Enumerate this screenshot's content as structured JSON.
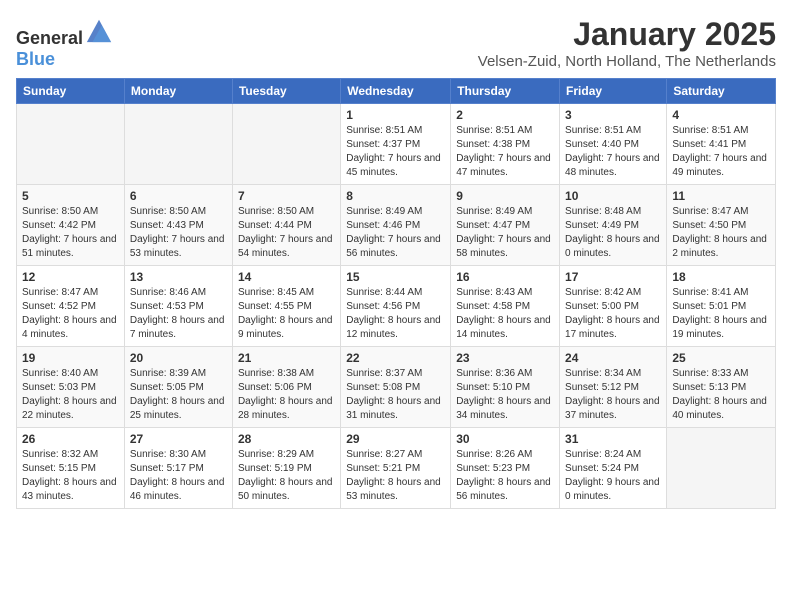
{
  "header": {
    "logo_general": "General",
    "logo_blue": "Blue",
    "month": "January 2025",
    "location": "Velsen-Zuid, North Holland, The Netherlands"
  },
  "weekdays": [
    "Sunday",
    "Monday",
    "Tuesday",
    "Wednesday",
    "Thursday",
    "Friday",
    "Saturday"
  ],
  "weeks": [
    [
      {
        "day": "",
        "info": ""
      },
      {
        "day": "",
        "info": ""
      },
      {
        "day": "",
        "info": ""
      },
      {
        "day": "1",
        "info": "Sunrise: 8:51 AM\nSunset: 4:37 PM\nDaylight: 7 hours and 45 minutes."
      },
      {
        "day": "2",
        "info": "Sunrise: 8:51 AM\nSunset: 4:38 PM\nDaylight: 7 hours and 47 minutes."
      },
      {
        "day": "3",
        "info": "Sunrise: 8:51 AM\nSunset: 4:40 PM\nDaylight: 7 hours and 48 minutes."
      },
      {
        "day": "4",
        "info": "Sunrise: 8:51 AM\nSunset: 4:41 PM\nDaylight: 7 hours and 49 minutes."
      }
    ],
    [
      {
        "day": "5",
        "info": "Sunrise: 8:50 AM\nSunset: 4:42 PM\nDaylight: 7 hours and 51 minutes."
      },
      {
        "day": "6",
        "info": "Sunrise: 8:50 AM\nSunset: 4:43 PM\nDaylight: 7 hours and 53 minutes."
      },
      {
        "day": "7",
        "info": "Sunrise: 8:50 AM\nSunset: 4:44 PM\nDaylight: 7 hours and 54 minutes."
      },
      {
        "day": "8",
        "info": "Sunrise: 8:49 AM\nSunset: 4:46 PM\nDaylight: 7 hours and 56 minutes."
      },
      {
        "day": "9",
        "info": "Sunrise: 8:49 AM\nSunset: 4:47 PM\nDaylight: 7 hours and 58 minutes."
      },
      {
        "day": "10",
        "info": "Sunrise: 8:48 AM\nSunset: 4:49 PM\nDaylight: 8 hours and 0 minutes."
      },
      {
        "day": "11",
        "info": "Sunrise: 8:47 AM\nSunset: 4:50 PM\nDaylight: 8 hours and 2 minutes."
      }
    ],
    [
      {
        "day": "12",
        "info": "Sunrise: 8:47 AM\nSunset: 4:52 PM\nDaylight: 8 hours and 4 minutes."
      },
      {
        "day": "13",
        "info": "Sunrise: 8:46 AM\nSunset: 4:53 PM\nDaylight: 8 hours and 7 minutes."
      },
      {
        "day": "14",
        "info": "Sunrise: 8:45 AM\nSunset: 4:55 PM\nDaylight: 8 hours and 9 minutes."
      },
      {
        "day": "15",
        "info": "Sunrise: 8:44 AM\nSunset: 4:56 PM\nDaylight: 8 hours and 12 minutes."
      },
      {
        "day": "16",
        "info": "Sunrise: 8:43 AM\nSunset: 4:58 PM\nDaylight: 8 hours and 14 minutes."
      },
      {
        "day": "17",
        "info": "Sunrise: 8:42 AM\nSunset: 5:00 PM\nDaylight: 8 hours and 17 minutes."
      },
      {
        "day": "18",
        "info": "Sunrise: 8:41 AM\nSunset: 5:01 PM\nDaylight: 8 hours and 19 minutes."
      }
    ],
    [
      {
        "day": "19",
        "info": "Sunrise: 8:40 AM\nSunset: 5:03 PM\nDaylight: 8 hours and 22 minutes."
      },
      {
        "day": "20",
        "info": "Sunrise: 8:39 AM\nSunset: 5:05 PM\nDaylight: 8 hours and 25 minutes."
      },
      {
        "day": "21",
        "info": "Sunrise: 8:38 AM\nSunset: 5:06 PM\nDaylight: 8 hours and 28 minutes."
      },
      {
        "day": "22",
        "info": "Sunrise: 8:37 AM\nSunset: 5:08 PM\nDaylight: 8 hours and 31 minutes."
      },
      {
        "day": "23",
        "info": "Sunrise: 8:36 AM\nSunset: 5:10 PM\nDaylight: 8 hours and 34 minutes."
      },
      {
        "day": "24",
        "info": "Sunrise: 8:34 AM\nSunset: 5:12 PM\nDaylight: 8 hours and 37 minutes."
      },
      {
        "day": "25",
        "info": "Sunrise: 8:33 AM\nSunset: 5:13 PM\nDaylight: 8 hours and 40 minutes."
      }
    ],
    [
      {
        "day": "26",
        "info": "Sunrise: 8:32 AM\nSunset: 5:15 PM\nDaylight: 8 hours and 43 minutes."
      },
      {
        "day": "27",
        "info": "Sunrise: 8:30 AM\nSunset: 5:17 PM\nDaylight: 8 hours and 46 minutes."
      },
      {
        "day": "28",
        "info": "Sunrise: 8:29 AM\nSunset: 5:19 PM\nDaylight: 8 hours and 50 minutes."
      },
      {
        "day": "29",
        "info": "Sunrise: 8:27 AM\nSunset: 5:21 PM\nDaylight: 8 hours and 53 minutes."
      },
      {
        "day": "30",
        "info": "Sunrise: 8:26 AM\nSunset: 5:23 PM\nDaylight: 8 hours and 56 minutes."
      },
      {
        "day": "31",
        "info": "Sunrise: 8:24 AM\nSunset: 5:24 PM\nDaylight: 9 hours and 0 minutes."
      },
      {
        "day": "",
        "info": ""
      }
    ]
  ]
}
